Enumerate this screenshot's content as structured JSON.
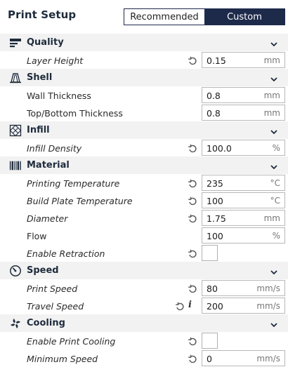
{
  "header": {
    "title": "Print Setup",
    "modes": [
      "Recommended",
      "Custom"
    ],
    "active_mode": "Custom"
  },
  "categories": [
    {
      "label": "Quality",
      "icon": "quality-icon",
      "settings": [
        {
          "label": "Layer Height",
          "italic": true,
          "reset": true,
          "info": false,
          "type": "field",
          "value": "0.15",
          "unit": "mm"
        }
      ]
    },
    {
      "label": "Shell",
      "icon": "shell-icon",
      "settings": [
        {
          "label": "Wall Thickness",
          "italic": false,
          "reset": false,
          "info": false,
          "type": "field",
          "value": "0.8",
          "unit": "mm"
        },
        {
          "label": "Top/Bottom Thickness",
          "italic": false,
          "reset": false,
          "info": false,
          "type": "field",
          "value": "0.8",
          "unit": "mm"
        }
      ]
    },
    {
      "label": "Infill",
      "icon": "infill-icon",
      "settings": [
        {
          "label": "Infill Density",
          "italic": true,
          "reset": true,
          "info": false,
          "type": "field",
          "value": "100.0",
          "unit": "%"
        }
      ]
    },
    {
      "label": "Material",
      "icon": "material-icon",
      "settings": [
        {
          "label": "Printing Temperature",
          "italic": true,
          "reset": true,
          "info": false,
          "type": "field",
          "value": "235",
          "unit": "°C"
        },
        {
          "label": "Build Plate Temperature",
          "italic": true,
          "reset": true,
          "info": false,
          "type": "field",
          "value": "100",
          "unit": "°C"
        },
        {
          "label": "Diameter",
          "italic": true,
          "reset": true,
          "info": false,
          "type": "field",
          "value": "1.75",
          "unit": "mm"
        },
        {
          "label": "Flow",
          "italic": false,
          "reset": false,
          "info": false,
          "type": "field",
          "value": "100",
          "unit": "%"
        },
        {
          "label": "Enable Retraction",
          "italic": true,
          "reset": true,
          "info": false,
          "type": "checkbox",
          "checked": false
        }
      ]
    },
    {
      "label": "Speed",
      "icon": "speed-icon",
      "settings": [
        {
          "label": "Print Speed",
          "italic": true,
          "reset": true,
          "info": false,
          "type": "field",
          "value": "80",
          "unit": "mm/s"
        },
        {
          "label": "Travel Speed",
          "italic": true,
          "reset": true,
          "info": true,
          "type": "field",
          "value": "200",
          "unit": "mm/s"
        }
      ]
    },
    {
      "label": "Cooling",
      "icon": "cooling-icon",
      "settings": [
        {
          "label": "Enable Print Cooling",
          "italic": true,
          "reset": true,
          "info": false,
          "type": "checkbox",
          "checked": false
        },
        {
          "label": "Minimum Speed",
          "italic": true,
          "reset": true,
          "info": false,
          "type": "field",
          "value": "0",
          "unit": "mm/s"
        }
      ]
    }
  ],
  "colors": {
    "accent": "#1e2a4a",
    "title": "#1e2b3c",
    "category_bg": "#f2f2f2",
    "field_border": "#b8b8b8"
  }
}
